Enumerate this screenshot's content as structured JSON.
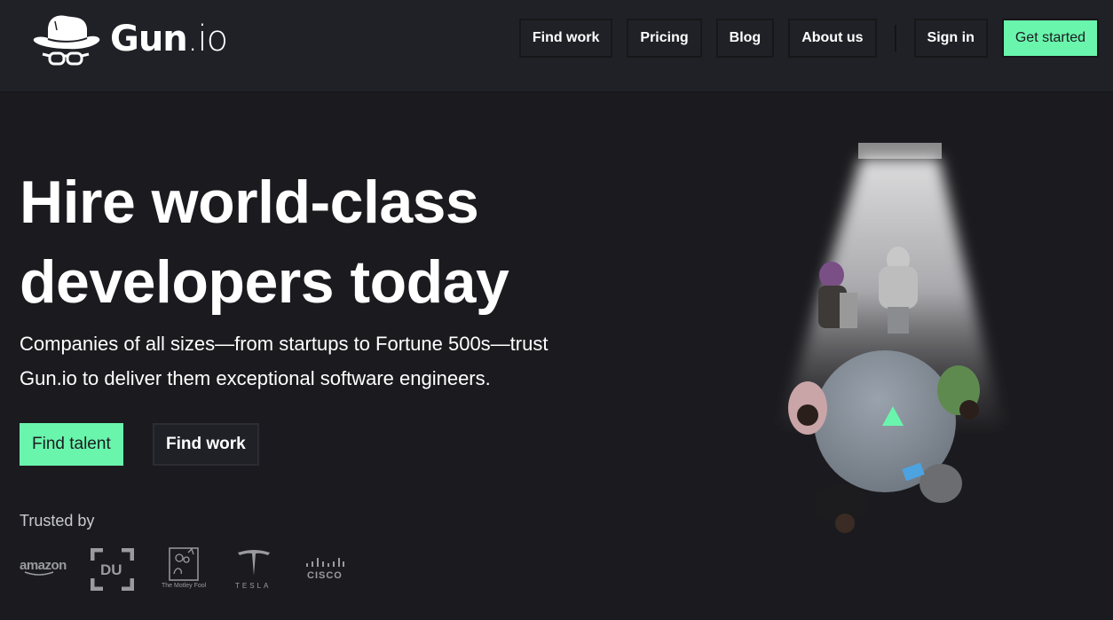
{
  "header": {
    "brand": {
      "name": "Gun",
      "suffix": ".io",
      "icon": "hat-glasses-logo-icon"
    },
    "nav": [
      {
        "label": "Find work"
      },
      {
        "label": "Pricing"
      },
      {
        "label": "Blog"
      },
      {
        "label": "About us"
      }
    ],
    "sign_in_label": "Sign in",
    "get_started_label": "Get started"
  },
  "hero": {
    "title_line1": "Hire world-class",
    "title_line2": "developers today",
    "subtitle_line1": "Companies of all sizes—from startups to Fortune 500s—trust",
    "subtitle_line2": "Gun.io to deliver them exceptional software engineers.",
    "primary_cta": "Find talent",
    "secondary_cta": "Find work",
    "illustration": "meeting-table-spotlight-illustration"
  },
  "trusted": {
    "label": "Trusted by",
    "logos": [
      {
        "name": "amazon",
        "text": "amazon"
      },
      {
        "name": "du",
        "text": "DU"
      },
      {
        "name": "motley-fool",
        "text": "The Motley Fool"
      },
      {
        "name": "tesla",
        "text": "TESLA"
      },
      {
        "name": "cisco",
        "text": "CISCO"
      }
    ]
  },
  "colors": {
    "accent": "#6af5ad",
    "header_bg": "#202127",
    "page_bg": "#1b1b1f",
    "logo_gray": "#9a9b9f"
  }
}
